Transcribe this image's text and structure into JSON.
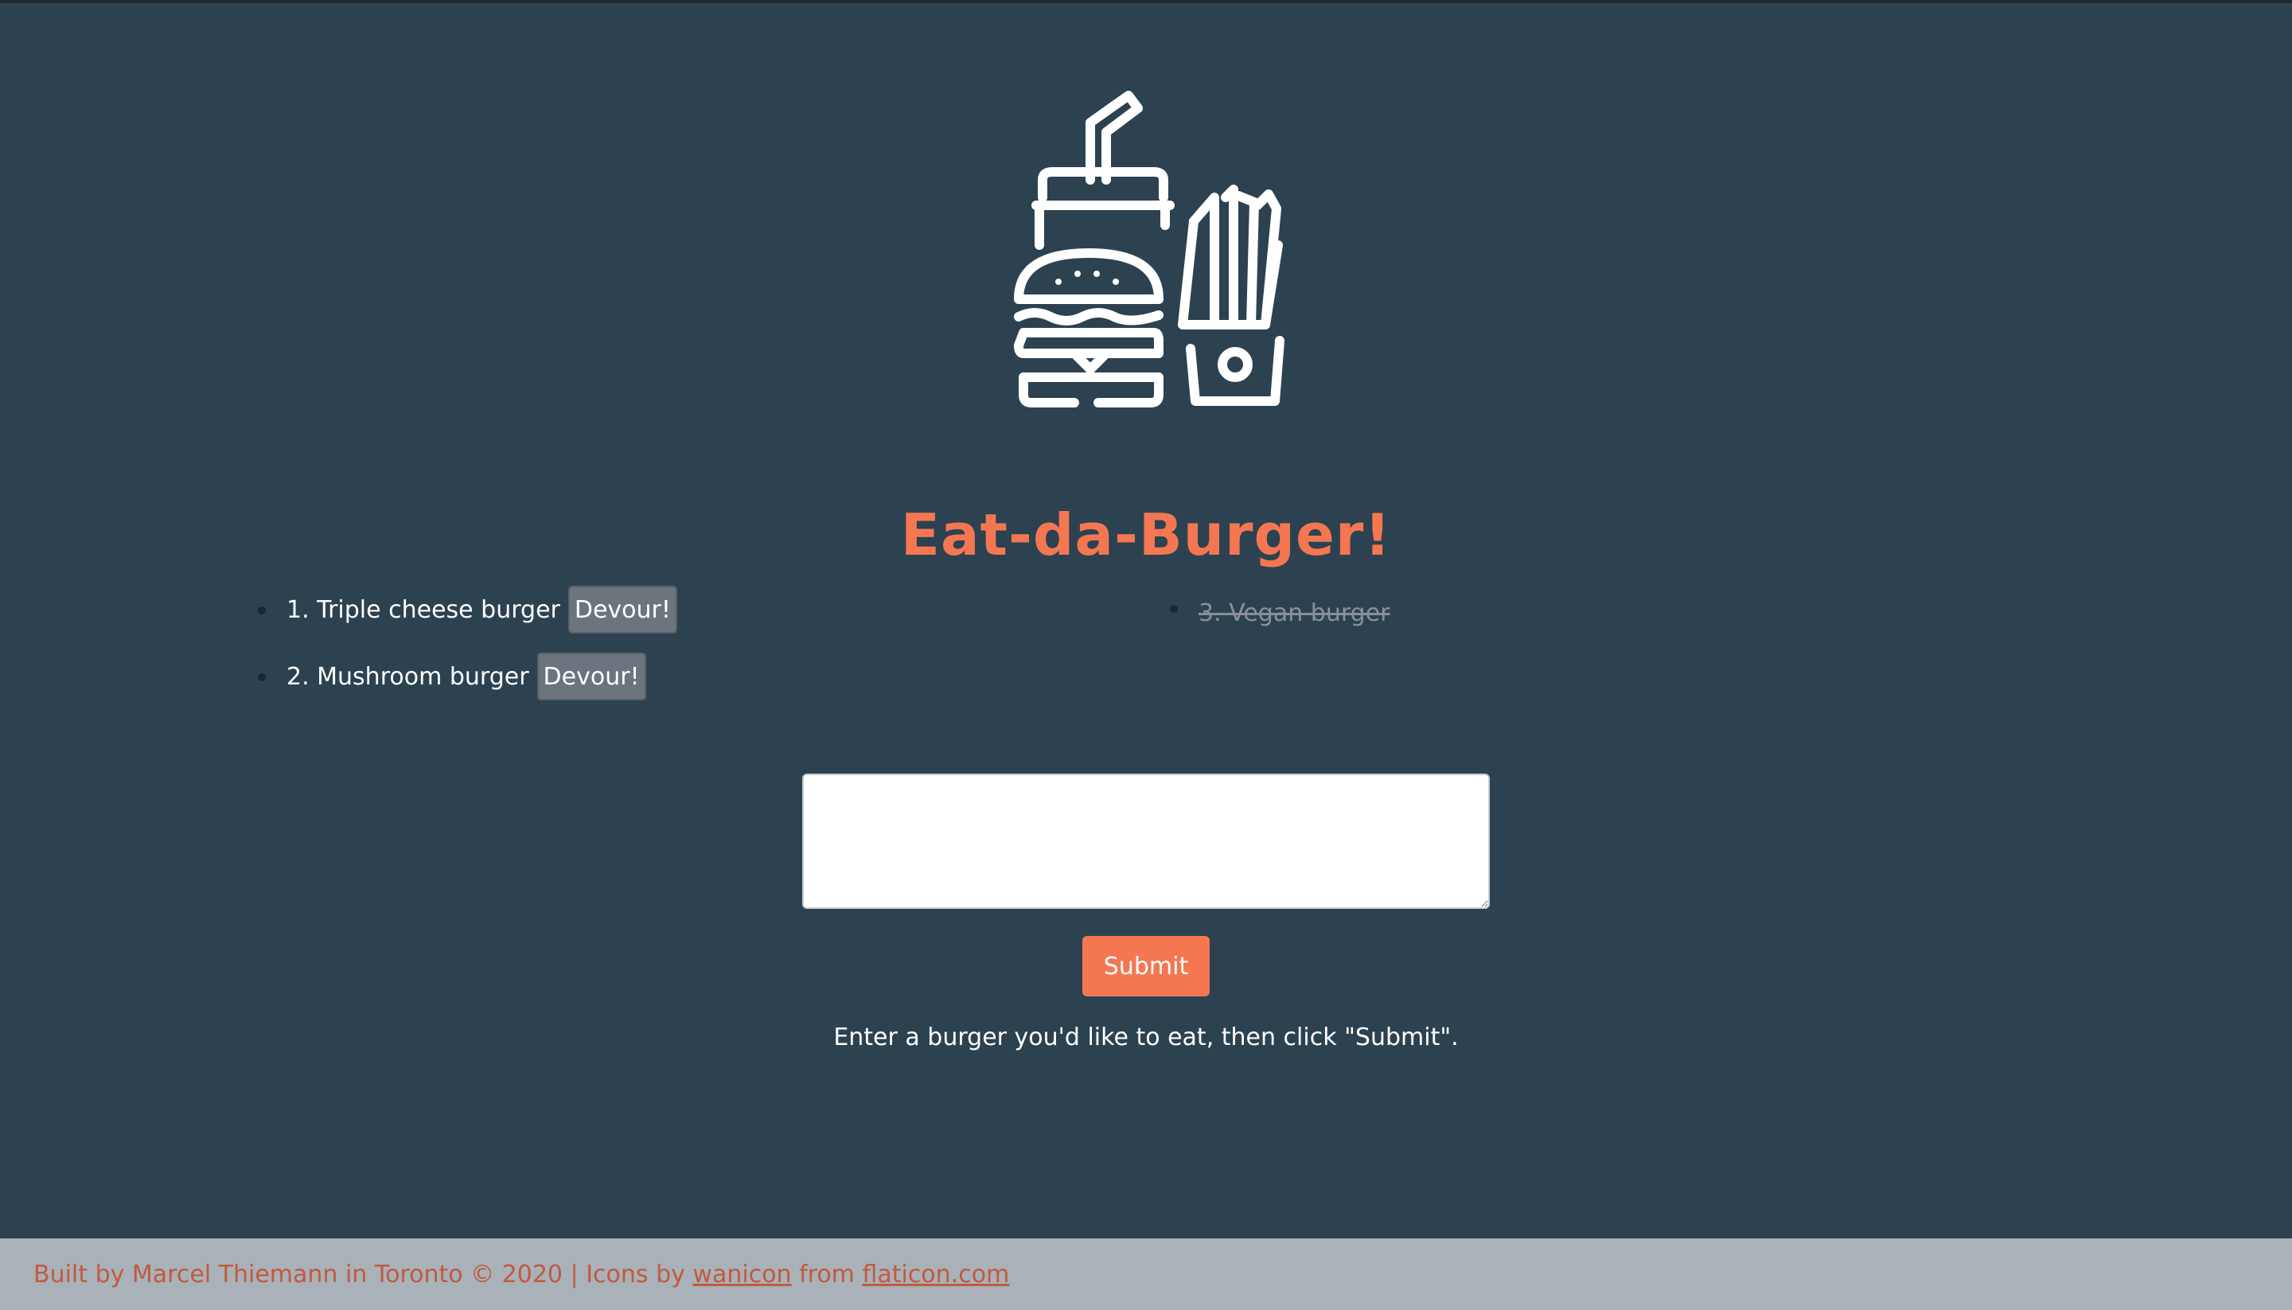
{
  "app": {
    "title": "Eat-da-Burger!",
    "logo_icon": "burger-combo-icon"
  },
  "burgers_waiting": [
    {
      "label": "1. Triple cheese burger",
      "button": "Devour!"
    },
    {
      "label": "2. Mushroom burger",
      "button": "Devour!"
    }
  ],
  "burgers_devoured": [
    {
      "label": "3. Vegan burger"
    }
  ],
  "form": {
    "input_value": "",
    "submit_label": "Submit",
    "instructions": "Enter a burger you'd like to eat, then click \"Submit\"."
  },
  "footer": {
    "prefix": "Built by Marcel Thiemann in Toronto © 2020 | Icons by ",
    "author_link": "wanicon",
    "middle": " from ",
    "site_link": "flaticon.com"
  },
  "colors": {
    "background": "#2c4251",
    "accent": "#f47752",
    "footer_bg": "#a9b1b9",
    "button_gray": "#6c757d"
  }
}
